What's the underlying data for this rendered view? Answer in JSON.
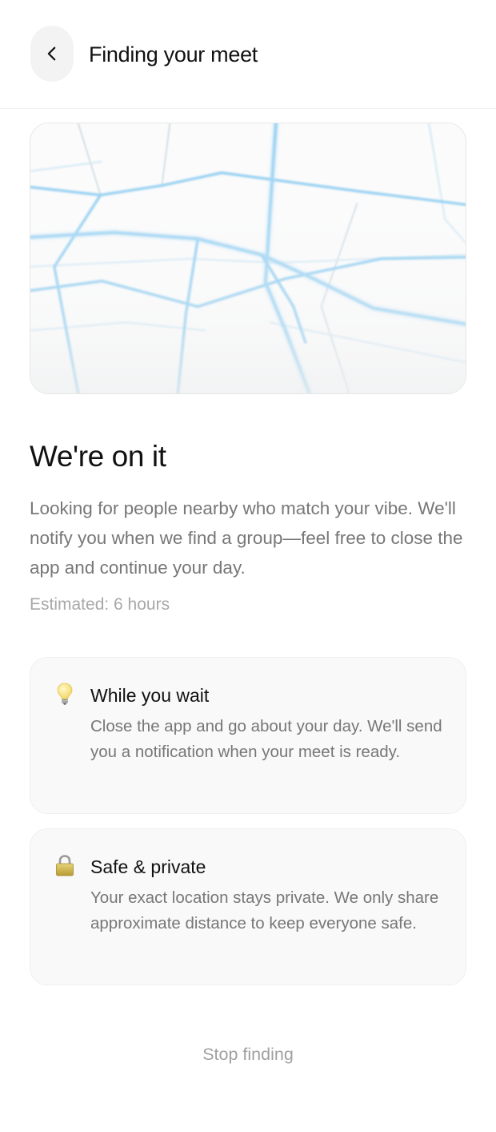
{
  "header": {
    "title": "Finding your meet",
    "back_icon": "chevron-left-icon"
  },
  "main": {
    "headline": "We're on it",
    "description": "Looking for people nearby who match your vibe. We'll notify you when we find a group—feel free to close the app and continue your day.",
    "estimate": "Estimated: 6 hours"
  },
  "cards": [
    {
      "icon": "lightbulb-icon",
      "title": "While you wait",
      "body": "Close the app and go about your day. We'll send you a notification when your meet is ready."
    },
    {
      "icon": "lock-icon",
      "title": "Safe & private",
      "body": "Your exact location stays private. We only share approximate distance to keep everyone safe."
    }
  ],
  "footer": {
    "stop_label": "Stop finding"
  },
  "colors": {
    "map_route": "#7fc4ee",
    "map_route_faint": "#d6ecf8",
    "text_muted": "#777777",
    "card_bg": "#f9f9f9"
  }
}
